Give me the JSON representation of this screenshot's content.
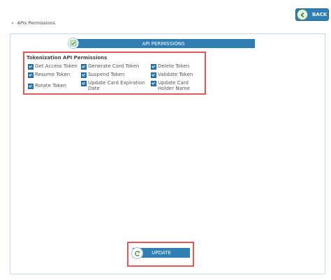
{
  "toolbar": {
    "back_label": "BACK"
  },
  "breadcrumb": {
    "current": "APIs Permissions"
  },
  "section": {
    "title": "API PERMISSIONS"
  },
  "permissions": {
    "group_title": "Tokenization API Permissions",
    "items": [
      {
        "label": "Get Access Token",
        "checked": true
      },
      {
        "label": "Generate Card Token",
        "checked": true
      },
      {
        "label": "Delete Token",
        "checked": true
      },
      {
        "label": "Resume Token",
        "checked": true
      },
      {
        "label": "Suspend Token",
        "checked": true
      },
      {
        "label": "Validate Token",
        "checked": true
      },
      {
        "label": "Rotate Token",
        "checked": true
      },
      {
        "label": "Update Card Expiration Date",
        "checked": true
      },
      {
        "label": "Update Card Holder Name",
        "checked": true
      }
    ]
  },
  "actions": {
    "update_label": "UPDATE"
  },
  "colors": {
    "primary": "#2f7fb4",
    "highlight_border": "#e05858",
    "panel_border": "#c5d9ea"
  }
}
